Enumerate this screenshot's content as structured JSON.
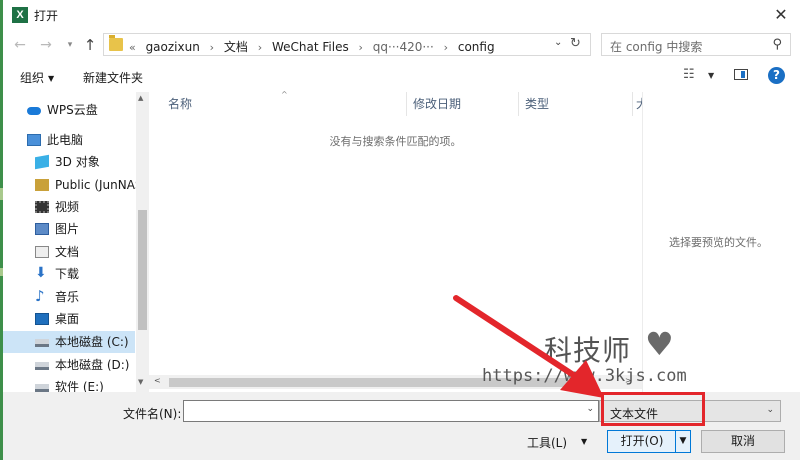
{
  "window": {
    "app_icon": "X",
    "title": "打开",
    "close_symbol": "✕"
  },
  "nav": {
    "back_symbol": "←",
    "forward_symbol": "→",
    "recent_symbol": "▾",
    "up_symbol": "↑"
  },
  "address": {
    "overflow": "«",
    "crumbs": [
      "gaozixun",
      "文档",
      "WeChat Files",
      "config"
    ],
    "obscured_segment": "qq···420···",
    "separator": "›",
    "dropdown_symbol": "⌄",
    "refresh_symbol": "↻"
  },
  "search": {
    "placeholder": "在 config 中搜索",
    "icon_glyph": "⚲"
  },
  "toolbar": {
    "organize": "组织",
    "caret": "▼",
    "new_folder": "新建文件夹",
    "help": "?",
    "view_glyph": "☷"
  },
  "sidebar": {
    "items": [
      {
        "label": "WPS云盘",
        "icon": "cloud-icon"
      },
      {
        "label": "此电脑",
        "icon": "computer-icon"
      },
      {
        "label": "3D 对象",
        "icon": "3d-objects-icon"
      },
      {
        "label": "Public (JunNAS",
        "icon": "network-folder-icon"
      },
      {
        "label": "视频",
        "icon": "video-icon"
      },
      {
        "label": "图片",
        "icon": "pictures-icon"
      },
      {
        "label": "文档",
        "icon": "documents-icon"
      },
      {
        "label": "下载",
        "icon": "download-icon"
      },
      {
        "label": "音乐",
        "icon": "music-icon"
      },
      {
        "label": "桌面",
        "icon": "desktop-icon"
      },
      {
        "label": "本地磁盘 (C:)",
        "icon": "drive-icon"
      },
      {
        "label": "本地磁盘 (D:)",
        "icon": "drive-icon"
      },
      {
        "label": "软件 (E:)",
        "icon": "drive-icon"
      }
    ],
    "download_glyph": "⬇",
    "music_glyph": "♪"
  },
  "filelist": {
    "columns": [
      "名称",
      "修改日期",
      "类型",
      "大"
    ],
    "sort_glyph": "^",
    "empty_message": "没有与搜索条件匹配的项。",
    "scroll_left": "<",
    "scroll_right": ">",
    "scroll_up": "▲",
    "scroll_down": "▼"
  },
  "preview": {
    "message": "选择要预览的文件。"
  },
  "bottom": {
    "filename_label": "文件名(N):",
    "filename_value": "",
    "filetype_value": "文本文件",
    "drop_symbol": "⌄",
    "tools": "工具(L)",
    "tools_caret": "▼",
    "open": "打开(O)",
    "open_drop": "▼",
    "cancel": "取消"
  },
  "watermark": {
    "brand": "科技师",
    "heart": "♥",
    "url": "https://www.3kjs.com"
  },
  "colors": {
    "highlight": "#e3262b",
    "accent": "#0078d7",
    "selection": "#cce4f7"
  }
}
